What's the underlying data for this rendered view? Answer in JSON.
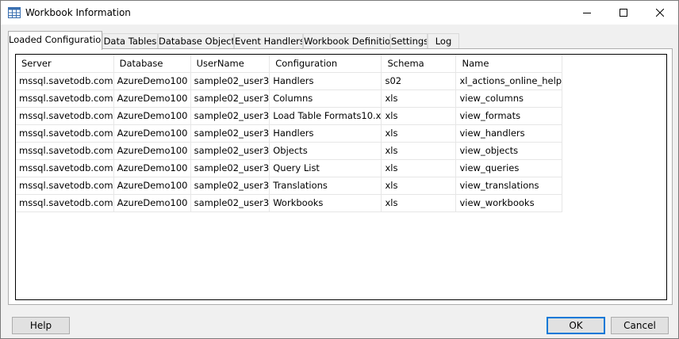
{
  "window": {
    "title": "Workbook Information"
  },
  "tabs": [
    {
      "label": "Loaded Configurations"
    },
    {
      "label": "Data Tables"
    },
    {
      "label": "Database Objects"
    },
    {
      "label": "Event Handlers"
    },
    {
      "label": "Workbook Definition"
    },
    {
      "label": "Settings"
    },
    {
      "label": "Log"
    }
  ],
  "table": {
    "columns": [
      "Server",
      "Database",
      "UserName",
      "Configuration",
      "Schema",
      "Name"
    ],
    "rows": [
      [
        "mssql.savetodb.com",
        "AzureDemo100",
        "sample02_user3",
        "Handlers",
        "s02",
        "xl_actions_online_help"
      ],
      [
        "mssql.savetodb.com",
        "AzureDemo100",
        "sample02_user3",
        "Columns",
        "xls",
        "view_columns"
      ],
      [
        "mssql.savetodb.com",
        "AzureDemo100",
        "sample02_user3",
        "Load Table Formats10.x",
        "xls",
        "view_formats"
      ],
      [
        "mssql.savetodb.com",
        "AzureDemo100",
        "sample02_user3",
        "Handlers",
        "xls",
        "view_handlers"
      ],
      [
        "mssql.savetodb.com",
        "AzureDemo100",
        "sample02_user3",
        "Objects",
        "xls",
        "view_objects"
      ],
      [
        "mssql.savetodb.com",
        "AzureDemo100",
        "sample02_user3",
        "Query List",
        "xls",
        "view_queries"
      ],
      [
        "mssql.savetodb.com",
        "AzureDemo100",
        "sample02_user3",
        "Translations",
        "xls",
        "view_translations"
      ],
      [
        "mssql.savetodb.com",
        "AzureDemo100",
        "sample02_user3",
        "Workbooks",
        "xls",
        "view_workbooks"
      ]
    ]
  },
  "buttons": {
    "help": "Help",
    "ok": "OK",
    "cancel": "Cancel"
  },
  "icons": {
    "app": "table-icon",
    "minimize": "minimize-icon",
    "maximize": "maximize-icon",
    "close": "close-icon"
  }
}
